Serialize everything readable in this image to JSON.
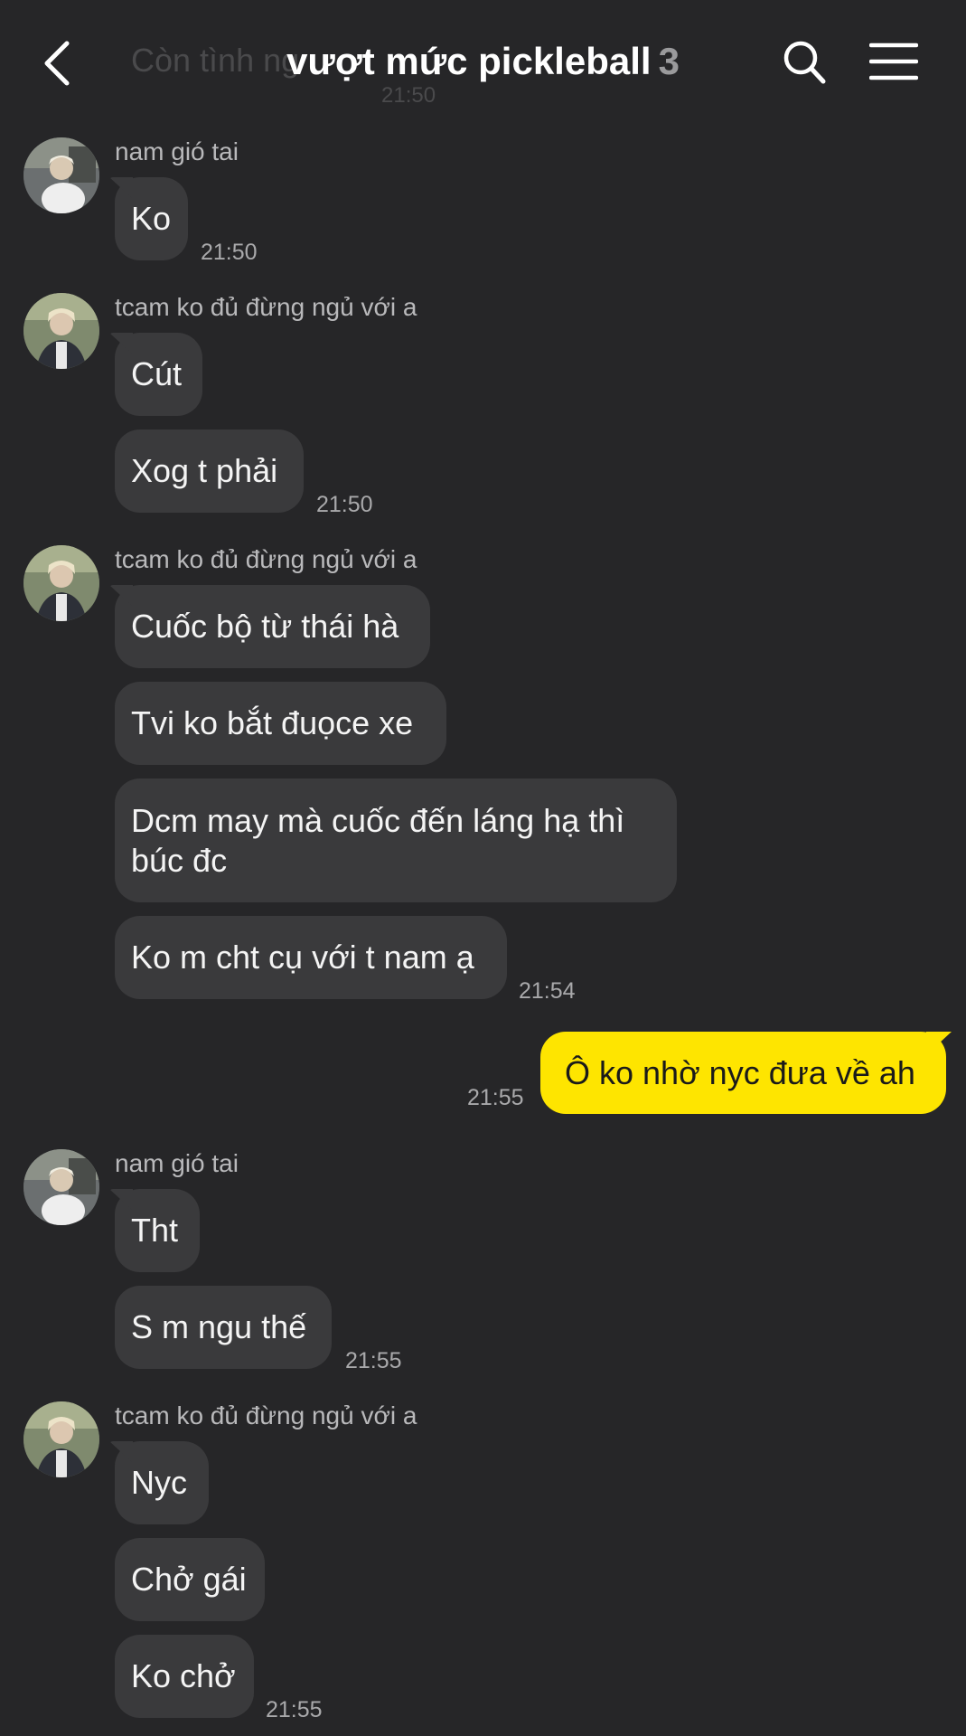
{
  "header": {
    "ghost_text": "Còn tình ng",
    "ghost_time": "21:50",
    "title": "vượt mức pickleball",
    "member_count": "3"
  },
  "messages": [
    {
      "sender": "nam gió tai",
      "avatar": "nam-gio-tai",
      "bubbles": [
        "Ko"
      ],
      "time": "21:50"
    },
    {
      "sender": "tcam ko đủ đừng ngủ với a",
      "avatar": "tcam",
      "bubbles": [
        "Cút",
        "Xog t phải"
      ],
      "time": "21:50"
    },
    {
      "sender": "tcam ko đủ đừng ngủ với a",
      "avatar": "tcam",
      "bubbles": [
        "Cuốc bộ từ thái hà",
        "Tvi ko bắt đuọce xe",
        "Dcm may mà cuốc đến láng hạ thì búc đc",
        "Ko m cht cụ với t nam ạ"
      ],
      "time": "21:54"
    },
    {
      "mine": true,
      "text": "Ô ko nhờ nyc đưa về ah",
      "time": "21:55"
    },
    {
      "sender": "nam gió tai",
      "avatar": "nam-gio-tai",
      "bubbles": [
        "Tht",
        "S m ngu thế"
      ],
      "time": "21:55"
    },
    {
      "sender": "tcam ko đủ đừng ngủ với a",
      "avatar": "tcam",
      "bubbles": [
        "Nyc",
        "Chở gái",
        "Ko chở"
      ],
      "time": "21:55"
    }
  ],
  "colors": {
    "background": "#262628",
    "bubble_other": "#3a3a3c",
    "bubble_mine": "#fee500"
  },
  "icons": [
    "back-arrow-icon",
    "search-icon",
    "hamburger-menu-icon"
  ]
}
